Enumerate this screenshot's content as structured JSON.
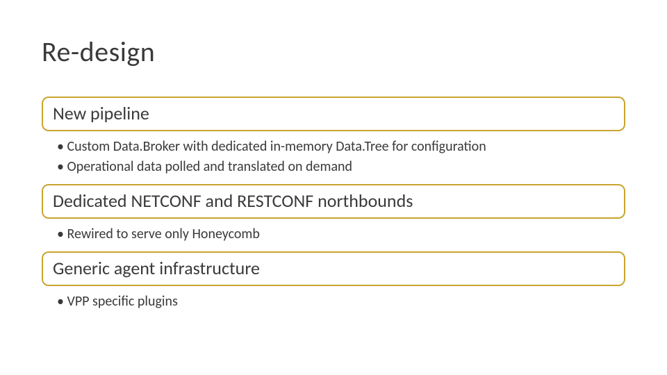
{
  "title": "Re-design",
  "sections": [
    {
      "heading": "New pipeline",
      "items": [
        "Custom Data.Broker with dedicated in-memory Data.Tree for configuration",
        "Operational data polled and translated on demand"
      ]
    },
    {
      "heading": "Dedicated NETCONF and RESTCONF northbounds",
      "items": [
        "Rewired to serve only Honeycomb"
      ]
    },
    {
      "heading": "Generic agent infrastructure",
      "items": [
        "VPP specific plugins"
      ]
    }
  ]
}
